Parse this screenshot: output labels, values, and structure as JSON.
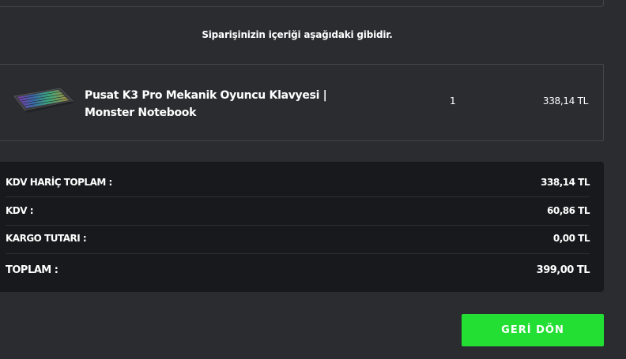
{
  "intro_text": "Siparişinizin içeriği aşağıdaki gibidir.",
  "product": {
    "name": "Pusat K3 Pro Mekanik Oyuncu Klavyesi | Monster Notebook",
    "quantity": "1",
    "price": "338,14 TL",
    "image_icon": "keyboard-image"
  },
  "totals": {
    "rows": [
      {
        "label": "KDV HARİÇ TOPLAM :",
        "value": "338,14 TL"
      },
      {
        "label": "KDV :",
        "value": "60,86 TL"
      },
      {
        "label": "KARGO TUTARI :",
        "value": "0,00 TL"
      },
      {
        "label": "TOPLAM :",
        "value": "399,00 TL"
      }
    ]
  },
  "back_button_label": "GERİ DÖN",
  "colors": {
    "page_background": "#2b2c30",
    "totals_background": "#18191c",
    "border": "#45464b",
    "button_green": "#23df33"
  }
}
